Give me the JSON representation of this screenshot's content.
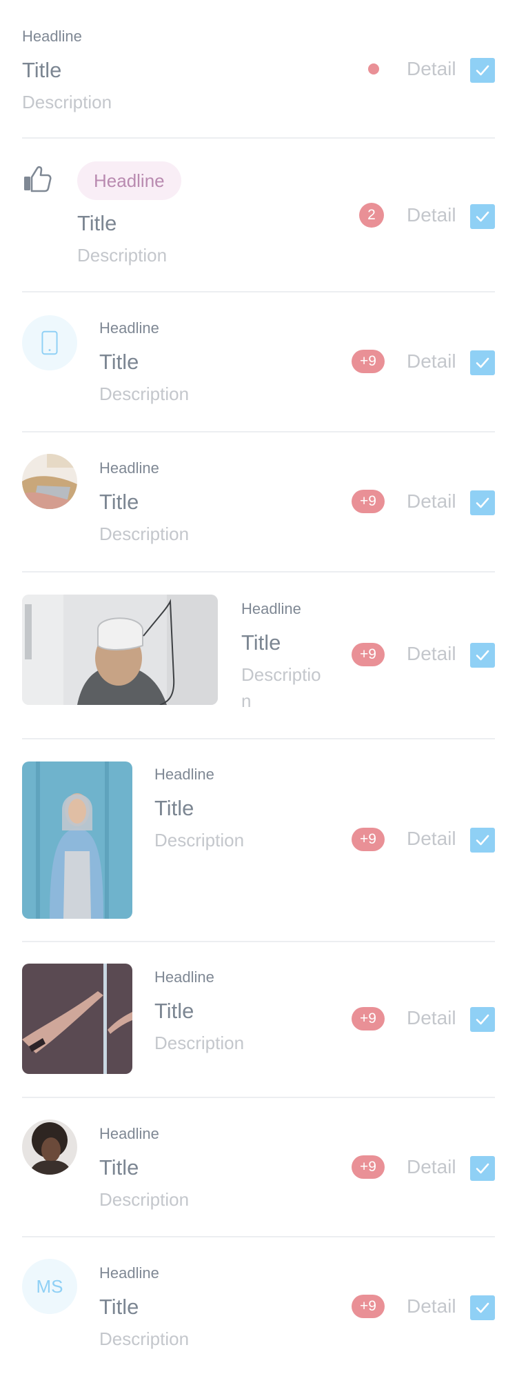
{
  "colors": {
    "badge": "#e99096",
    "checkbox": "#8fd0f5",
    "chip_bg": "#f9eef6",
    "chip_text": "#b98ab0"
  },
  "items": [
    {
      "headline": "Headline",
      "title": "Title",
      "description": "Description",
      "detail": "Detail",
      "checked": true,
      "indicator": "dot"
    },
    {
      "headline": "Headline",
      "title": "Title",
      "description": "Description",
      "detail": "Detail",
      "checked": true,
      "badge": "2",
      "leading": "thumbs-up-icon"
    },
    {
      "headline": "Headline",
      "title": "Title",
      "description": "Description",
      "detail": "Detail",
      "checked": true,
      "badge": "+9",
      "leading": "phone-icon"
    },
    {
      "headline": "Headline",
      "title": "Title",
      "description": "Description",
      "detail": "Detail",
      "checked": true,
      "badge": "+9",
      "leading": "avatar-photo"
    },
    {
      "headline": "Headline",
      "title": "Title",
      "description": "Description",
      "detail": "Detail",
      "checked": true,
      "badge": "+9",
      "leading": "wide-photo-vr-headset"
    },
    {
      "headline": "Headline",
      "title": "Title",
      "description": "Description",
      "detail": "Detail",
      "checked": true,
      "badge": "+9",
      "leading": "tall-photo-person"
    },
    {
      "headline": "Headline",
      "title": "Title",
      "description": "Description",
      "detail": "Detail",
      "checked": true,
      "badge": "+9",
      "leading": "square-photo-hands"
    },
    {
      "headline": "Headline",
      "title": "Title",
      "description": "Description",
      "detail": "Detail",
      "checked": true,
      "badge": "+9",
      "leading": "avatar-photo-portrait"
    },
    {
      "headline": "Headline",
      "title": "Title",
      "description": "Description",
      "detail": "Detail",
      "checked": true,
      "badge": "+9",
      "leading": "initials",
      "initials": "MS"
    }
  ]
}
